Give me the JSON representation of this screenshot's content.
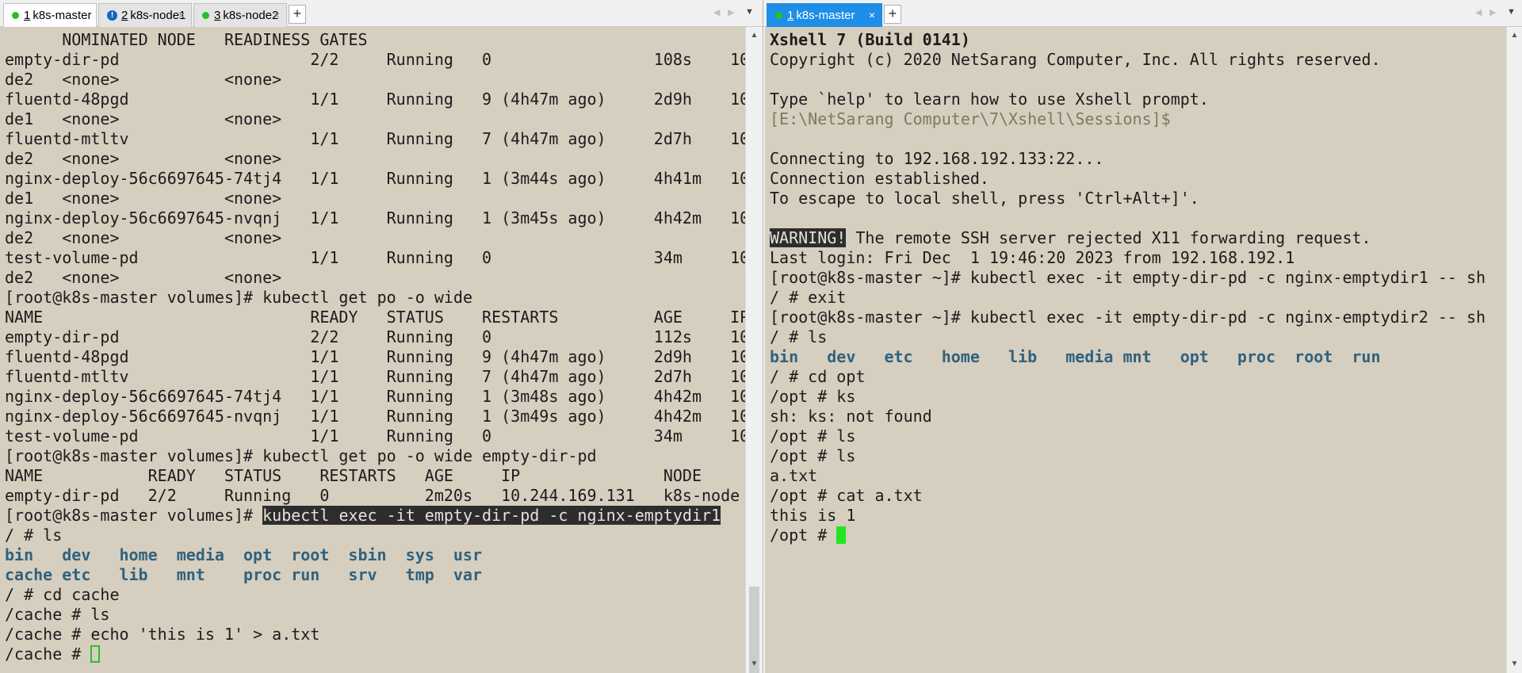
{
  "left_pane": {
    "tabs": [
      {
        "num": "1",
        "label": "k8s-master",
        "status": "connected"
      },
      {
        "num": "2",
        "label": "k8s-node1",
        "status": "info"
      },
      {
        "num": "3",
        "label": "k8s-node2",
        "status": "connected"
      }
    ],
    "add_tab": "+",
    "terminal_lines": [
      "      NOMINATED NODE   READINESS GATES",
      "empty-dir-pd                    2/2     Running   0                 108s    10.",
      "de2   <none>           <none>",
      "fluentd-48pgd                   1/1     Running   9 (4h47m ago)     2d9h    10.",
      "de1   <none>           <none>",
      "fluentd-mtltv                   1/1     Running   7 (4h47m ago)     2d7h    10.",
      "de2   <none>           <none>",
      "nginx-deploy-56c6697645-74tj4   1/1     Running   1 (3m44s ago)     4h41m   10.",
      "de1   <none>           <none>",
      "nginx-deploy-56c6697645-nvqnj   1/1     Running   1 (3m45s ago)     4h42m   10.",
      "de2   <none>           <none>",
      "test-volume-pd                  1/1     Running   0                 34m     10.",
      "de2   <none>           <none>",
      "[root@k8s-master volumes]# kubectl get po -o wide",
      "NAME                            READY   STATUS    RESTARTS          AGE     IP",
      "empty-dir-pd                    2/2     Running   0                 112s    10.",
      "fluentd-48pgd                   1/1     Running   9 (4h47m ago)     2d9h    10.",
      "fluentd-mtltv                   1/1     Running   7 (4h47m ago)     2d7h    10.",
      "nginx-deploy-56c6697645-74tj4   1/1     Running   1 (3m48s ago)     4h42m   10.",
      "nginx-deploy-56c6697645-nvqnj   1/1     Running   1 (3m49s ago)     4h42m   10.",
      "test-volume-pd                  1/1     Running   0                 34m     10.",
      "[root@k8s-master volumes]# kubectl get po -o wide empty-dir-pd",
      "NAME           READY   STATUS    RESTARTS   AGE     IP               NODE",
      "empty-dir-pd   2/2     Running   0          2m20s   10.244.169.131   k8s-node"
    ],
    "exec_prompt": "[root@k8s-master volumes]# ",
    "exec_command": "kubectl exec -it empty-dir-pd -c nginx-emptydir1",
    "ls_cmd": "/ # ls",
    "ls_row1": [
      "bin",
      "dev",
      "home",
      "media",
      "opt",
      "root",
      "sbin",
      "sys",
      "usr"
    ],
    "ls_row2": [
      "cache",
      "etc",
      "lib",
      "mnt",
      "proc",
      "run",
      "srv",
      "tmp",
      "var"
    ],
    "after_lines": [
      "/ # cd cache",
      "/cache # ls",
      "/cache # echo 'this is 1' > a.txt"
    ],
    "final_prompt": "/cache # "
  },
  "right_pane": {
    "tab": {
      "num": "1",
      "label": "k8s-master"
    },
    "add_tab": "+",
    "banner_title": "Xshell 7 (Build 0141)",
    "copyright": "Copyright (c) 2020 NetSarang Computer, Inc. All rights reserved.",
    "help_line": "Type `help' to learn how to use Xshell prompt.",
    "session_path": "[E:\\NetSarang Computer\\7\\Xshell\\Sessions]$",
    "conn_lines": [
      "Connecting to 192.168.192.133:22...",
      "Connection established.",
      "To escape to local shell, press 'Ctrl+Alt+]'."
    ],
    "warning_tag": "WARNING!",
    "warning_text": " The remote SSH server rejected X11 forwarding request.",
    "lines_a": [
      "Last login: Fri Dec  1 19:46:20 2023 from 192.168.192.1",
      "[root@k8s-master ~]# kubectl exec -it empty-dir-pd -c nginx-emptydir1 -- sh",
      "/ # exit",
      "[root@k8s-master ~]# kubectl exec -it empty-dir-pd -c nginx-emptydir2 -- sh",
      "/ # ls"
    ],
    "ls_row": [
      "bin",
      "dev",
      "etc",
      "home",
      "lib",
      "media",
      "mnt",
      "opt",
      "proc",
      "root",
      "run"
    ],
    "lines_b": [
      "/ # cd opt",
      "/opt # ks",
      "sh: ks: not found",
      "/opt # ls",
      "/opt # ls",
      "a.txt",
      "/opt # cat a.txt",
      "this is 1"
    ],
    "final_prompt": "/opt # "
  },
  "colors": {
    "terminal_bg": "#d6cebf",
    "directory": "#30627e",
    "active_tab": "#1e8ee8",
    "cursor": "#22e622"
  }
}
